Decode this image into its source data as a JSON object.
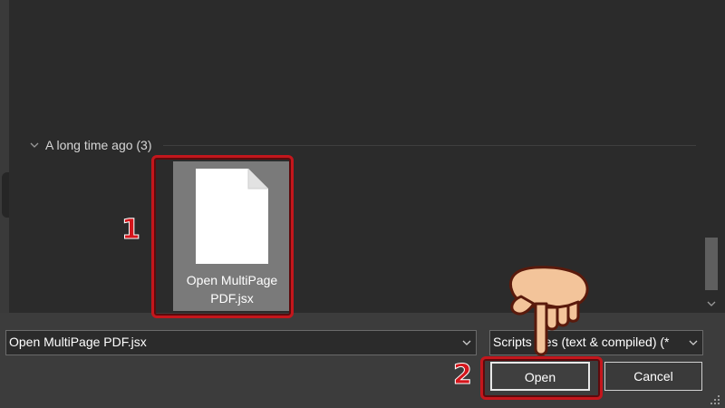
{
  "browser": {
    "group_header": "A long time ago (3)",
    "file": {
      "name_line1": "Open MultiPage",
      "name_line2": "PDF.jsx"
    }
  },
  "bottom": {
    "filename_value": "Open MultiPage PDF.jsx",
    "filetype_value": "Scripts files (text & compiled) (*",
    "open_label": "Open",
    "cancel_label": "Cancel"
  },
  "annotations": {
    "step1": "1",
    "step2": "2",
    "highlight_color": "#c4161c"
  },
  "icons": {
    "group_chevron": "chevron-down-icon",
    "combo_arrow": "chevron-down-icon",
    "file": "document-icon",
    "pointer": "pointing-hand-icon"
  }
}
